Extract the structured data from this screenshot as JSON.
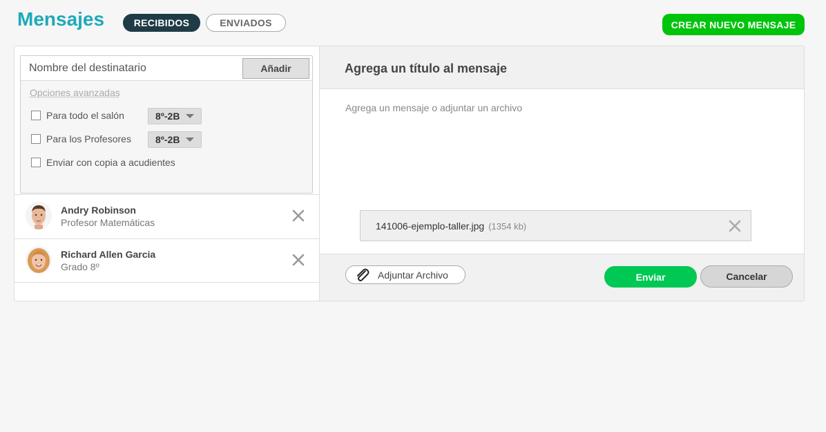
{
  "header": {
    "title": "Mensajes",
    "tabs": [
      {
        "label": "RECIBIDOS",
        "active": true
      },
      {
        "label": "ENVIADOS",
        "active": false
      }
    ],
    "new_message_label": "CREAR NUEVO MENSAJE"
  },
  "recipients_form": {
    "input_placeholder": "Nombre del destinatario",
    "add_label": "Añadir",
    "advanced_label": "Opciones avanzadas",
    "options": [
      {
        "label": "Para todo el salón",
        "select": "8º-2B",
        "checked": false
      },
      {
        "label": "Para los Profesores",
        "select": "8º-2B",
        "checked": false
      },
      {
        "label": "Enviar con copia a acudientes",
        "checked": false
      }
    ]
  },
  "recipients": [
    {
      "name": "Andry Robinson",
      "subtitle": "Profesor Matemáticas",
      "avatar": "male-avatar"
    },
    {
      "name": "Richard Allen Garcia",
      "subtitle": "Grado 8º",
      "avatar": "female-avatar"
    }
  ],
  "compose": {
    "title_placeholder": "Agrega un título al mensaje",
    "body_placeholder": "Agrega un mensaje o adjuntar un archivo",
    "attachment": {
      "filename": "141006-ejemplo-taller.jpg",
      "size": "(1354 kb)"
    },
    "attach_label": "Adjuntar Archivo",
    "send_label": "Enviar",
    "cancel_label": "Cancelar"
  },
  "colors": {
    "title": "#1eaab7",
    "tab_active": "#1f3b46",
    "new_button": "#00c40c",
    "send_button": "#00c854"
  }
}
